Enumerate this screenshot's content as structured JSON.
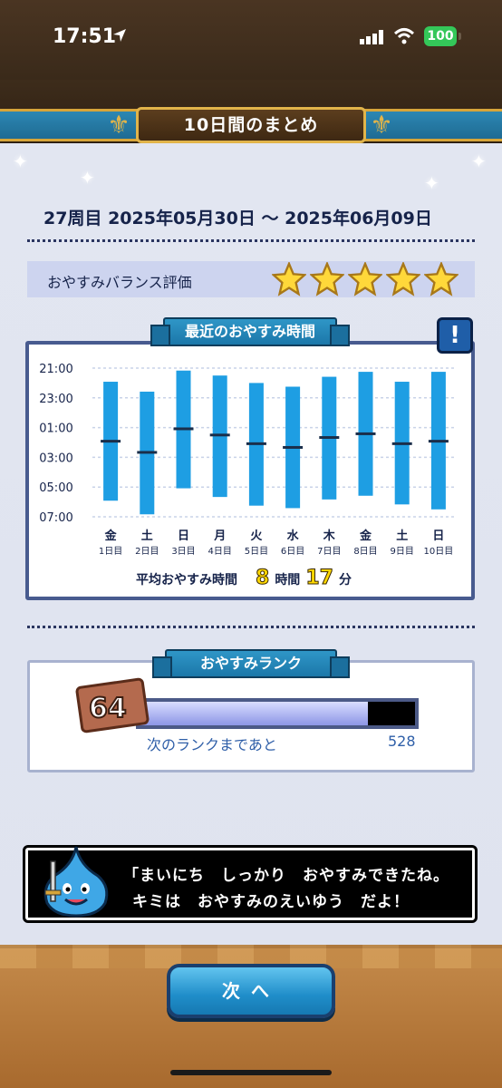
{
  "status_bar": {
    "time": "17:51",
    "battery": "100"
  },
  "header": {
    "title": "10日間のまとめ"
  },
  "summary": {
    "week": "27周目",
    "start_date": "2025年05月30日",
    "separator": "〜",
    "end_date": "2025年06月09日",
    "balance_label": "おやすみバランス評価",
    "stars": 5
  },
  "sleep_chart": {
    "title": "最近のおやすみ時間",
    "alert": "!",
    "average_label": "平均おやすみ時間",
    "average_hours": "8",
    "hours_unit": "時間",
    "average_minutes": "17",
    "minutes_unit": "分"
  },
  "chart_data": {
    "type": "bar",
    "y_ticks": [
      "21:00",
      "23:00",
      "01:00",
      "03:00",
      "05:00",
      "07:00"
    ],
    "ylim_hours_from_21": [
      0,
      10
    ],
    "categories": [
      {
        "weekday": "金",
        "day": "1日目"
      },
      {
        "weekday": "土",
        "day": "2日目"
      },
      {
        "weekday": "日",
        "day": "3日目"
      },
      {
        "weekday": "月",
        "day": "4日目"
      },
      {
        "weekday": "火",
        "day": "5日目"
      },
      {
        "weekday": "水",
        "day": "6日目"
      },
      {
        "weekday": "木",
        "day": "7日目"
      },
      {
        "weekday": "金",
        "day": "8日目"
      },
      {
        "weekday": "土",
        "day": "9日目"
      },
      {
        "weekday": "日",
        "day": "10日目"
      }
    ],
    "series": [
      {
        "start": [
          "21:55",
          "22:35",
          "21:10",
          "21:30",
          "22:00",
          "22:15",
          "21:35",
          "21:15",
          "21:55",
          "21:15"
        ],
        "end": [
          "05:55",
          "06:50",
          "05:05",
          "05:40",
          "06:15",
          "06:25",
          "05:50",
          "05:35",
          "06:10",
          "06:30"
        ],
        "mid": [
          "01:55",
          "02:40",
          "01:05",
          "01:30",
          "02:05",
          "02:20",
          "01:40",
          "01:25",
          "02:05",
          "01:55"
        ]
      }
    ],
    "bar_color": "#1e9ee3"
  },
  "rank": {
    "title": "おやすみランク",
    "level": "64",
    "progress": 0.83,
    "next_label": "次のランクまであと",
    "next_value": "528"
  },
  "message": {
    "line1": "「まいにち　しっかり　おやすみできたね。",
    "line2": "キミは　おやすみのえいゆう　だよ！"
  },
  "footer": {
    "next_button": "次へ"
  },
  "colors": {
    "accent": "#1e9ee3",
    "navy": "#16234a",
    "gold": "#ffd800"
  }
}
